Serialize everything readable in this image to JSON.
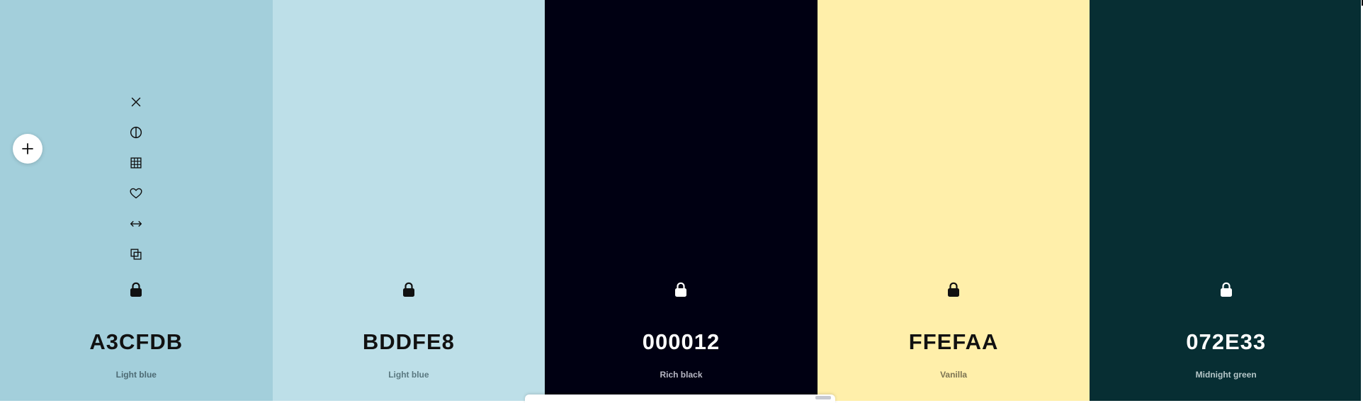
{
  "palette": {
    "swatches": [
      {
        "hex": "A3CFDB",
        "name": "Light blue",
        "bg": "#A3CFDB",
        "fg": "#111111",
        "sub": "#4d6a73"
      },
      {
        "hex": "BDDFE8",
        "name": "Light blue",
        "bg": "#BDDFE8",
        "fg": "#111111",
        "sub": "#5a7880"
      },
      {
        "hex": "000012",
        "name": "Rich black",
        "bg": "#000012",
        "fg": "#ffffff",
        "sub": "#b8b8c4"
      },
      {
        "hex": "FFEFAA",
        "name": "Vanilla",
        "bg": "#FFEFAA",
        "fg": "#111111",
        "sub": "#7b7352"
      },
      {
        "hex": "072E33",
        "name": "Midnight green",
        "bg": "#072E33",
        "fg": "#ffffff",
        "sub": "#b6c7c9"
      }
    ]
  },
  "toolbar": {
    "icons": [
      "close-icon",
      "contrast-icon",
      "shades-grid-icon",
      "heart-icon",
      "drag-arrows-icon",
      "copy-icon"
    ]
  },
  "icons": {
    "lock": "lock-icon",
    "add": "plus-icon"
  }
}
